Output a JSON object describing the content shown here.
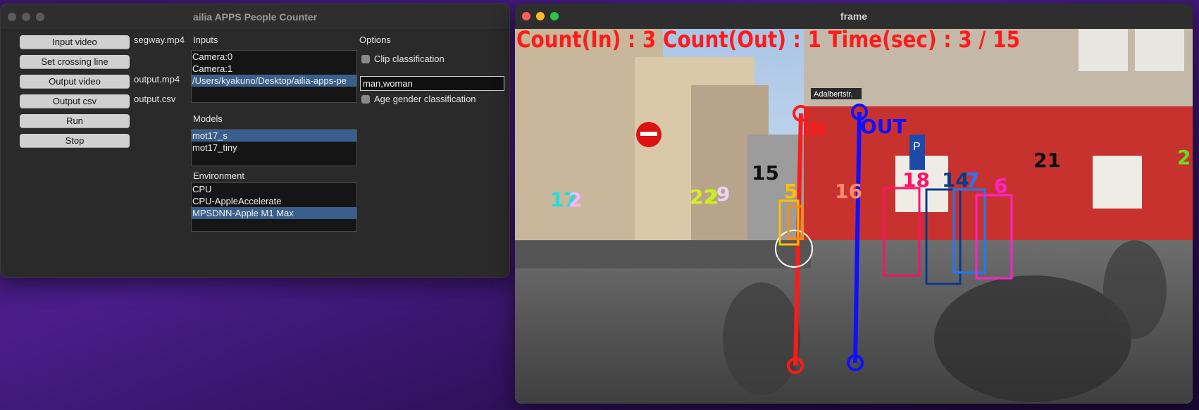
{
  "app": {
    "title": "ailia APPS People Counter",
    "buttons": {
      "input_video": "Input video",
      "set_crossing_line": "Set crossing line",
      "output_video": "Output video",
      "output_csv": "Output csv",
      "run": "Run",
      "stop": "Stop"
    },
    "files": {
      "input": "segway.mp4",
      "output_video": "output.mp4",
      "output_csv": "output.csv"
    },
    "inputs": {
      "label": "Inputs",
      "items": [
        "Camera:0",
        "Camera:1",
        "/Users/kyakuno/Desktop/ailia-apps-pe"
      ],
      "selected_index": 2
    },
    "models": {
      "label": "Models",
      "items": [
        "mot17_s",
        "mot17_tiny"
      ],
      "selected_index": 0
    },
    "environment": {
      "label": "Environment",
      "items": [
        "CPU",
        "CPU-AppleAccelerate",
        "MPSDNN-Apple M1 Max"
      ],
      "selected_index": 2
    },
    "options": {
      "label": "Options",
      "clip_classification": "Clip classification",
      "clip_text": "man,woman",
      "age_gender": "Age gender classification"
    }
  },
  "frame": {
    "title": "frame",
    "counter_text": "Count(In) : 3 Count(Out) : 1 Time(sec) : 3 / 15",
    "in_label": "IN",
    "out_label": "OUT",
    "sign_text": "Adalbertstr.",
    "track_ids": [
      "17",
      "2",
      "22",
      "2",
      "9",
      "15",
      "5",
      "16",
      "18",
      "14",
      "7",
      "6",
      "21",
      "2"
    ]
  },
  "colors": {
    "in_line": "#ff1a1a",
    "out_line": "#1010ff",
    "counter_text": "#ff1a1a",
    "selection": "#3b5f8c"
  }
}
